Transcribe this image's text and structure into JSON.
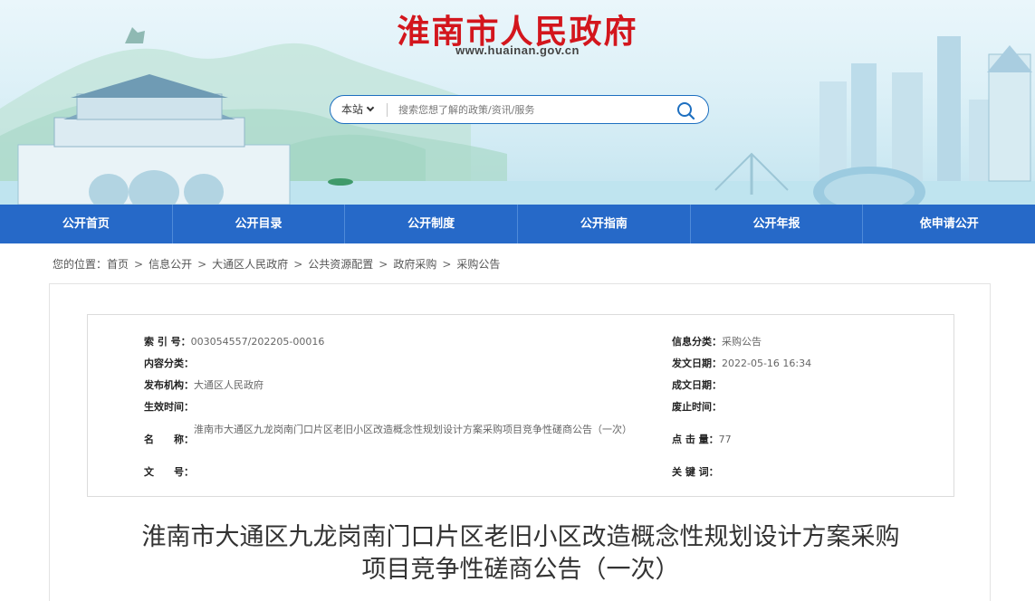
{
  "header": {
    "site_title": "淮南市人民政府",
    "site_domain": "www.huainan.gov.cn"
  },
  "search": {
    "scope_label": "本站",
    "placeholder": "搜索您想了解的政策/资讯/服务"
  },
  "nav": {
    "items": [
      {
        "label": "公开首页"
      },
      {
        "label": "公开目录"
      },
      {
        "label": "公开制度"
      },
      {
        "label": "公开指南"
      },
      {
        "label": "公开年报"
      },
      {
        "label": "依申请公开"
      }
    ]
  },
  "breadcrumb": {
    "prefix": "您的位置：",
    "items": [
      "首页",
      "信息公开",
      "大通区人民政府",
      "公共资源配置",
      "政府采购",
      "采购公告"
    ],
    "separator": ">"
  },
  "meta": {
    "index_label": "索 引 号：",
    "index_value": "003054557/202205-00016",
    "content_class_label": "内容分类：",
    "content_class_value": "",
    "publisher_label": "发布机构：",
    "publisher_value": "大通区人民政府",
    "effective_label": "生效时间：",
    "effective_value": "",
    "name_label": "名　　称：",
    "name_value": "淮南市大通区九龙岗南门口片区老旧小区改造概念性规划设计方案采购项目竞争性磋商公告（一次）",
    "docno_label": "文　　号：",
    "docno_value": "",
    "info_class_label": "信息分类：",
    "info_class_value": "采购公告",
    "publish_date_label": "发文日期：",
    "publish_date_value": "2022-05-16 16:34",
    "created_date_label": "成文日期：",
    "created_date_value": "",
    "expire_label": "废止时间：",
    "expire_value": "",
    "hits_label": "点 击 量：",
    "hits_value": "77",
    "keywords_label": "关 键 词：",
    "keywords_value": ""
  },
  "article": {
    "title_line1": "淮南市大通区九龙岗南门口片区老旧小区改造概念性规划设计方案采购",
    "title_line2": "项目竞争性磋商公告（一次）"
  },
  "colors": {
    "brand_red": "#d3161d",
    "nav_blue": "#2669c8",
    "search_border": "#1d6fc0"
  }
}
